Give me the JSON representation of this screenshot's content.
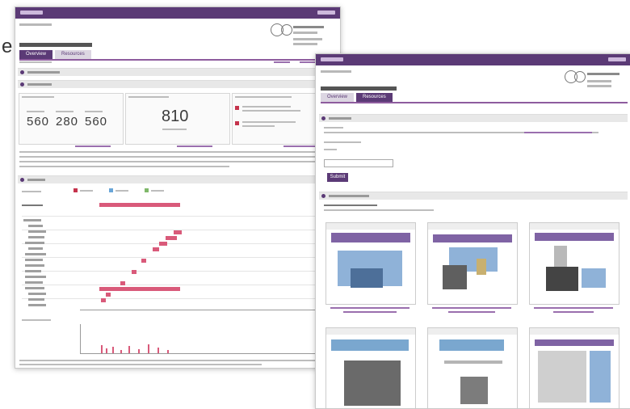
{
  "edge_fragment": "e",
  "left_window": {
    "tabs": [
      {
        "label": "Overview"
      },
      {
        "label": "Resources"
      }
    ],
    "stats": [
      "560",
      "280",
      "560"
    ],
    "center_value": "810",
    "colors": {
      "brand": "#5b3a76",
      "accent_red": "#c5334c",
      "heat": "#d95a7a",
      "legend_blue": "#69a6d8",
      "legend_green": "#7fb86a"
    }
  },
  "right_window": {
    "tabs": [
      {
        "label": "Overview"
      },
      {
        "label": "Resources"
      }
    ],
    "submit_label": "Submit"
  }
}
